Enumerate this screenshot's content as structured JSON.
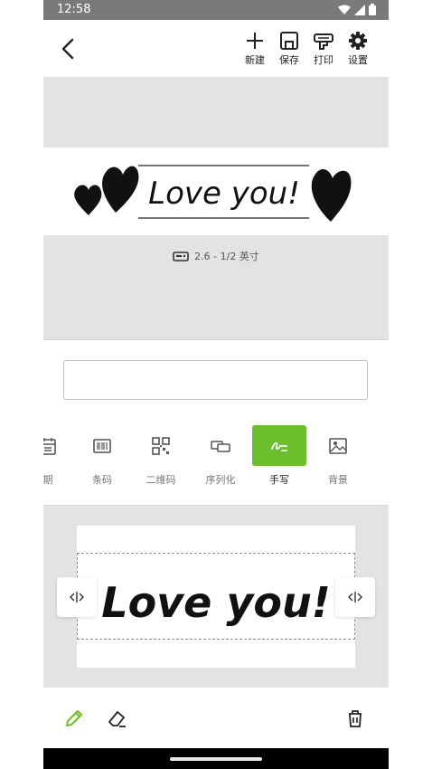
{
  "status_bar": {
    "time": "12:58"
  },
  "header": {
    "tools": [
      {
        "icon": "plus-icon",
        "label": "新建"
      },
      {
        "icon": "save-icon",
        "label": "保存"
      },
      {
        "icon": "printer-icon",
        "label": "打印"
      },
      {
        "icon": "gear-icon",
        "label": "设置"
      }
    ]
  },
  "preview": {
    "label_text": "Love you!",
    "size_text": "2.6 - 1/2 英寸"
  },
  "input": {
    "value": ""
  },
  "tabs": [
    {
      "label": "期",
      "icon": "calendar-icon",
      "active": false
    },
    {
      "label": "条码",
      "icon": "barcode-icon",
      "active": false
    },
    {
      "label": "二维码",
      "icon": "qrcode-icon",
      "active": false
    },
    {
      "label": "序列化",
      "icon": "serial-icon",
      "active": false
    },
    {
      "label": "手写",
      "icon": "handwriting-icon",
      "active": true
    },
    {
      "label": "背景",
      "icon": "image-icon",
      "active": false
    }
  ],
  "canvas": {
    "text": "Love you!"
  },
  "colors": {
    "accent": "#6cbf2a",
    "panel": "#e3e3e3"
  }
}
